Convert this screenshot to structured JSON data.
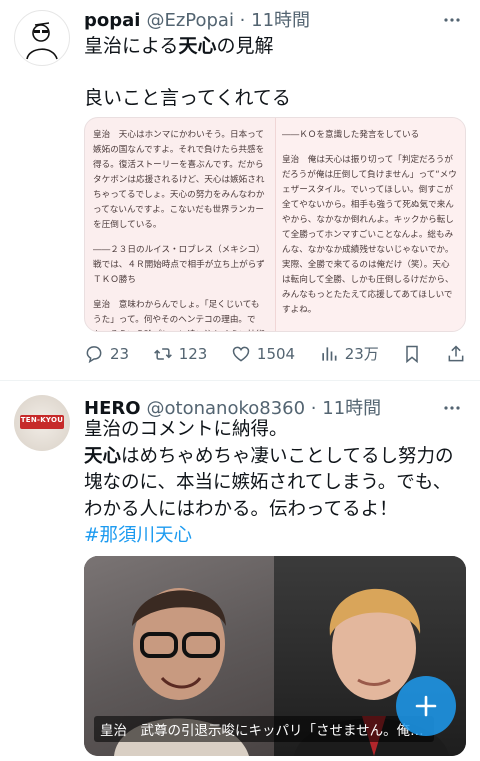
{
  "tweet1": {
    "display_name": "popai",
    "handle_time": "@EzPopai · 11時間",
    "line1_pre": "皇治による",
    "line1_bold": "天心",
    "line1_post": "の見解",
    "line2": "良いこと言ってくれてる",
    "article": {
      "left_p1": "皇治　天心はホンマにかわいそう。日本って嫉妬の国なんですよ。それで負けたら共感を得る。復活ストーリーを喜ぶんです。だからタケボンは応援されるけど、天心は嫉妬されちゃってるでしょ。天心の努力をみんなわかってないんですよ。こないだも世界ランカーを圧倒している。",
      "left_p2": "――２３日のルイス・ロブレス（メキシコ）戦では、４Ｒ開始時点で相手が立ち上がらずＴＫＯ勝ち",
      "left_p3": "皇治　意味わからんでしょ。「足くじいてもうた」って。何やそのヘンテコの理由。でも、そういう珍プレーに追い込むくらい技術の差があった。そこをみんな、あんまり受け入れへん",
      "right_p1": "――ＫＯを意識した発言をしている",
      "right_p2": "皇治　俺は天心は振り切って「判定だろうがだろうが俺は圧倒して負けません」って“メウェザースタイル。でいってほしい。倒すこが全てやないから。相手も強うて死ぬ気で来んやから、なかなか倒れんよ。キックから転して全勝ってホンマすごいことなんよ。総もみんな、なかなか成績残せないじゃないでか。実際、全勝で来てるのは俺だけ（笑）。天心は転向して全勝、しかも圧倒しるけだから、みんなもっとたたえて応援してあてほしいですよね。"
    },
    "replies": "23",
    "retweets": "123",
    "likes": "1504",
    "views": "23万"
  },
  "tweet2": {
    "display_name": "HERO",
    "handle_time": "@otonanoko8360 · 11時間",
    "line1": "皇治のコメントに納得。",
    "line2_bold": "天心",
    "line2_post": "はめちゃめちゃ凄いことしてるし努力の",
    "line3": "塊なのに、本当に嫉妬されてしまう。でも、",
    "line4": "わかる人にはわかる。伝わってるよ！",
    "hashtag": "#那須川天心",
    "avatar_text": "TEN-KYOU",
    "caption": "皇治　武尊の引退示唆にキッパリ「させません。俺…"
  },
  "colors": {
    "accent": "#1d9bf0",
    "secondary_text": "#536471"
  },
  "icons": [
    "more-icon",
    "reply-icon",
    "retweet-icon",
    "like-icon",
    "views-icon",
    "bookmark-icon",
    "share-icon",
    "compose-icon"
  ]
}
